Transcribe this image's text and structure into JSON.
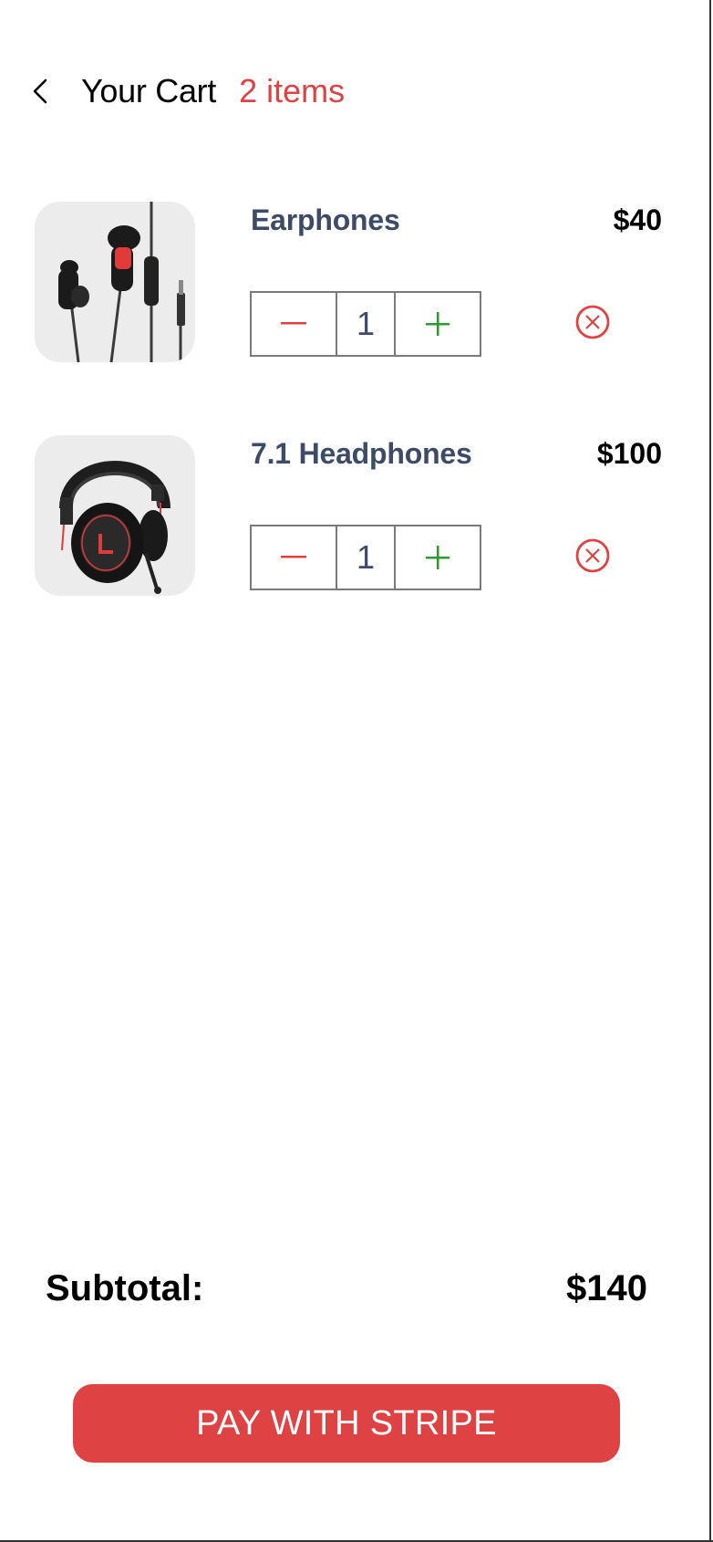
{
  "header": {
    "title": "Your Cart",
    "item_count": "2 items"
  },
  "items": [
    {
      "name": "Earphones",
      "price": "$40",
      "quantity": "1",
      "image": "earphones-image"
    },
    {
      "name": "7.1 Headphones",
      "price": "$100",
      "quantity": "1",
      "image": "headphones-image"
    }
  ],
  "footer": {
    "subtotal_label": "Subtotal:",
    "subtotal_value": "$140",
    "pay_label": "PAY WITH STRIPE"
  },
  "colors": {
    "accent": "#df4242",
    "product_name": "#3d4b66",
    "plus": "#2e9b2e",
    "thumb_bg": "#ececec"
  }
}
